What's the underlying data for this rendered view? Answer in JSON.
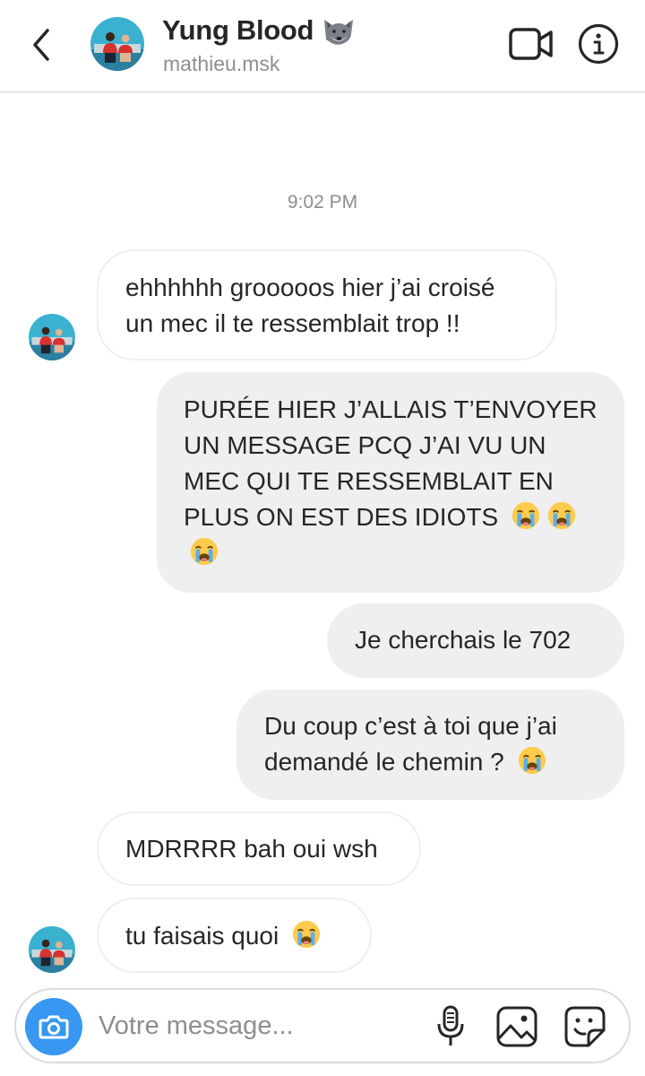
{
  "header": {
    "back_icon": "chevron-left-icon",
    "title": "Yung Blood",
    "title_emoji": "wolf-emoji",
    "username": "mathieu.msk",
    "video_call_icon": "video-camera-icon",
    "info_icon": "info-icon"
  },
  "conversation": {
    "timestamp": "9:02 PM",
    "messages": [
      {
        "direction": "incoming",
        "text": "ehhhhhh grooooos hier j’ai croisé un mec il te ressemblait trop !!",
        "emojis": []
      },
      {
        "direction": "outgoing",
        "text": "PURÉE HIER J’ALLAIS T’ENVOYER UN MESSAGE PCQ J’AI VU UN MEC QUI TE RESSEMBLAIT EN PLUS ON EST DES IDIOTS",
        "emojis": [
          "loudly-crying-face",
          "loudly-crying-face",
          "loudly-crying-face"
        ]
      },
      {
        "direction": "outgoing",
        "text": "Je cherchais le 702",
        "emojis": []
      },
      {
        "direction": "outgoing",
        "text": "Du coup c’est à toi que j’ai demandé le chemin ?",
        "emojis": [
          "loudly-crying-face"
        ]
      },
      {
        "direction": "incoming",
        "text": "MDRRRR bah oui wsh",
        "emojis": []
      },
      {
        "direction": "incoming",
        "text": "tu faisais quoi",
        "emojis": [
          "loudly-crying-face"
        ]
      }
    ]
  },
  "composer": {
    "placeholder": "Votre message...",
    "camera_icon": "camera-icon",
    "mic_icon": "microphone-icon",
    "gallery_icon": "image-gallery-icon",
    "sticker_icon": "sticker-icon"
  },
  "colors": {
    "accent": "#3897f0",
    "outgoing_bubble": "#efefef",
    "incoming_border": "#efefef",
    "secondary_text": "#8e8e8e",
    "primary_text": "#262626"
  }
}
